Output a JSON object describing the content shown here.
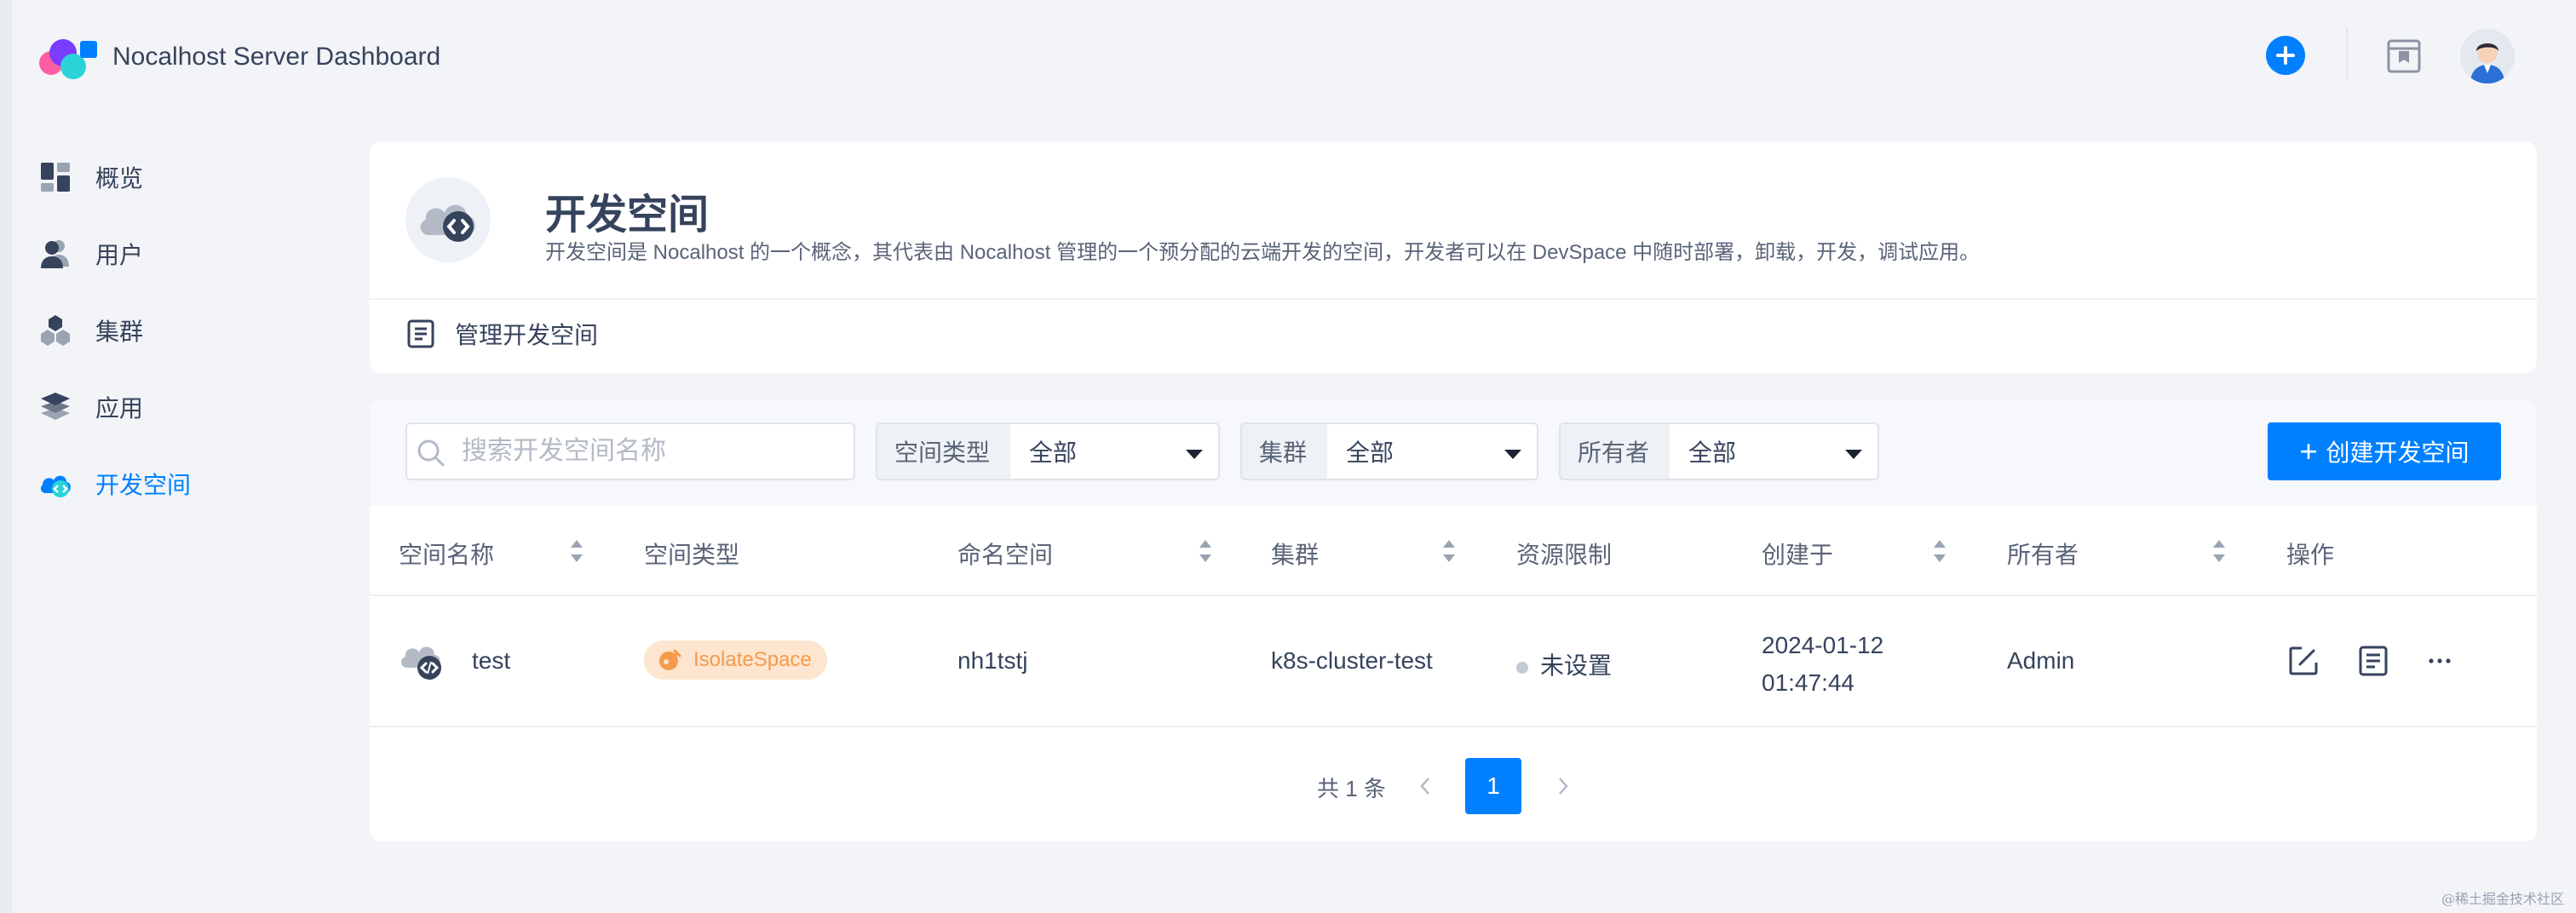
{
  "header": {
    "app_title": "Nocalhost Server Dashboard",
    "logo_icon": "nocalhost-logo",
    "add_icon": "plus-circle-icon",
    "doc_icon": "bookmark-doc-icon",
    "avatar_icon": "user-avatar"
  },
  "sidebar": {
    "items": [
      {
        "label": "概览",
        "icon": "dashboard-icon",
        "active": false
      },
      {
        "label": "用户",
        "icon": "users-icon",
        "active": false
      },
      {
        "label": "集群",
        "icon": "cluster-icon",
        "active": false
      },
      {
        "label": "应用",
        "icon": "layers-icon",
        "active": false
      },
      {
        "label": "开发空间",
        "icon": "cloud-code-icon",
        "active": true
      }
    ]
  },
  "page": {
    "title": "开发空间",
    "description": "开发空间是 Nocalhost 的一个概念，其代表由 Nocalhost 管理的一个预分配的云端开发的空间，开发者可以在 DevSpace 中随时部署，卸载，开发，调试应用。",
    "manage_link": "管理开发空间"
  },
  "filters": {
    "search_placeholder": "搜索开发空间名称",
    "space_type": {
      "label": "空间类型",
      "value": "全部"
    },
    "cluster": {
      "label": "集群",
      "value": "全部"
    },
    "owner": {
      "label": "所有者",
      "value": "全部"
    },
    "create_button": "创建开发空间"
  },
  "table": {
    "columns": [
      "空间名称",
      "空间类型",
      "命名空间",
      "集群",
      "资源限制",
      "创建于",
      "所有者",
      "操作"
    ],
    "rows": [
      {
        "name": "test",
        "space_type": "IsolateSpace",
        "namespace": "nh1tstj",
        "cluster": "k8s-cluster-test",
        "resource_limit": "未设置",
        "created_date": "2024-01-12",
        "created_time": "01:47:44",
        "owner": "Admin"
      }
    ]
  },
  "pagination": {
    "total_text": "共 1 条",
    "current_page": "1"
  },
  "colors": {
    "accent": "#0080ff",
    "badge_bg": "#fde5cf",
    "badge_text": "#f59a4b"
  },
  "watermark": "@稀土掘金技术社区"
}
